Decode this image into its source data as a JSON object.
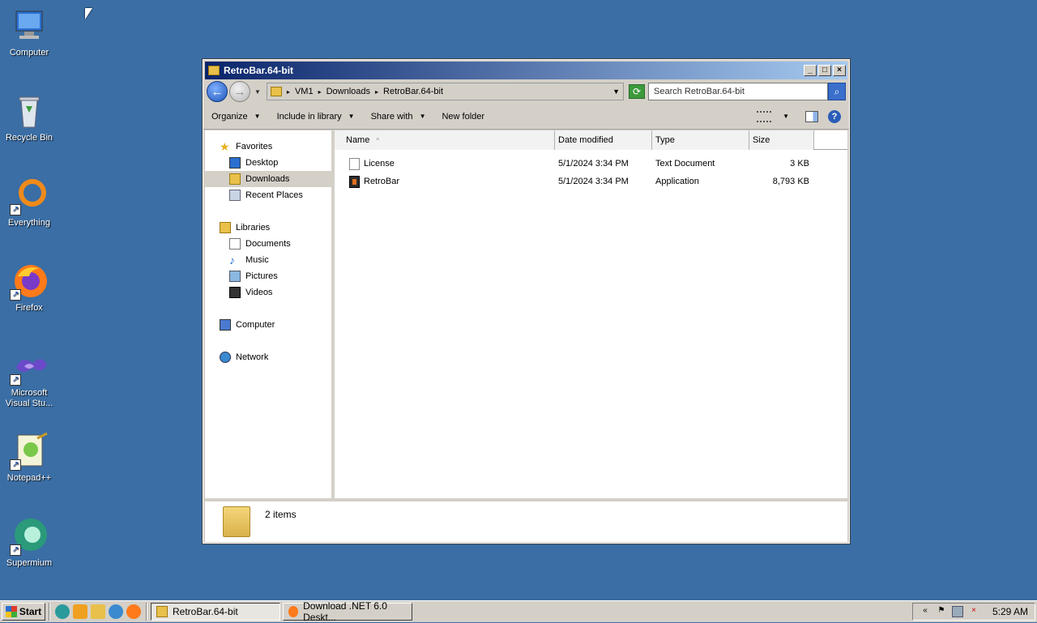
{
  "desktop": {
    "icons": [
      {
        "label": "Computer"
      },
      {
        "label": "Recycle Bin"
      },
      {
        "label": "Everything"
      },
      {
        "label": "Firefox"
      },
      {
        "label": "Microsoft Visual Stu..."
      },
      {
        "label": "Notepad++"
      },
      {
        "label": "Supermium"
      }
    ]
  },
  "window": {
    "title": "RetroBar.64-bit",
    "breadcrumb": [
      "VM1",
      "Downloads",
      "RetroBar.64-bit"
    ],
    "search_placeholder": "Search RetroBar.64-bit",
    "toolbar": {
      "organize": "Organize",
      "include_in_library": "Include in library",
      "share_with": "Share with",
      "new_folder": "New folder"
    },
    "nav": {
      "favorites": "Favorites",
      "desktop": "Desktop",
      "downloads": "Downloads",
      "recent_places": "Recent Places",
      "libraries": "Libraries",
      "documents": "Documents",
      "music": "Music",
      "pictures": "Pictures",
      "videos": "Videos",
      "computer": "Computer",
      "network": "Network"
    },
    "columns": {
      "name": "Name",
      "date_modified": "Date modified",
      "type": "Type",
      "size": "Size"
    },
    "files": [
      {
        "name": "License",
        "date": "5/1/2024 3:34 PM",
        "type": "Text Document",
        "size": "3 KB"
      },
      {
        "name": "RetroBar",
        "date": "5/1/2024 3:34 PM",
        "type": "Application",
        "size": "8,793 KB"
      }
    ],
    "status": {
      "item_count": "2 items"
    }
  },
  "taskbar": {
    "start": "Start",
    "tasks": [
      {
        "label": "RetroBar.64-bit"
      },
      {
        "label": "Download .NET 6.0 Deskt..."
      }
    ],
    "clock": "5:29 AM",
    "tray_expand": "«"
  }
}
